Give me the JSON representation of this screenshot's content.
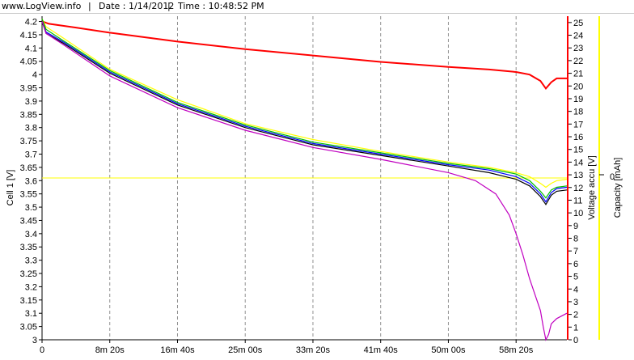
{
  "header": {
    "site": "www.LogView.info",
    "sep": "|",
    "date": "Date : 1/14/2012",
    "time": "Time : 10:48:52 PM"
  },
  "chart_data": {
    "type": "line",
    "x_tick_labels": [
      "0",
      "8m 20s",
      "16m 40s",
      "25m 00s",
      "33m 20s",
      "41m 40s",
      "50m 00s",
      "58m 20s"
    ],
    "x_tick_seconds": [
      0,
      500,
      1000,
      1500,
      2000,
      2500,
      3000,
      3500
    ],
    "xlim": [
      0,
      3875
    ],
    "axes": {
      "left": {
        "label": "Cell 1 [V]",
        "ylim": [
          3.0,
          4.22
        ],
        "ticks": [
          3,
          3.05,
          3.1,
          3.15,
          3.2,
          3.25,
          3.3,
          3.35,
          3.4,
          3.45,
          3.5,
          3.55,
          3.6,
          3.65,
          3.7,
          3.75,
          3.8,
          3.85,
          3.9,
          3.95,
          4,
          4.05,
          4.1,
          4.15,
          4.2
        ],
        "color": "#000000"
      },
      "right1": {
        "label": "Voltage accu [V]",
        "ylim": [
          0,
          25.5
        ],
        "ticks": [
          0,
          1,
          2,
          3,
          4,
          5,
          6,
          7,
          8,
          9,
          10,
          11,
          12,
          13,
          14,
          15,
          16,
          17,
          18,
          19,
          20,
          21,
          22,
          23,
          24,
          25
        ],
        "color": "#ff0000"
      },
      "right2": {
        "label": "Capacity [mAh]",
        "tick_label": "0",
        "color": "#ffff00"
      }
    },
    "grid": "vertical-dashed",
    "series": [
      {
        "axis": "right1",
        "color": "#ff0000",
        "x": [
          0,
          50,
          250,
          500,
          1000,
          1500,
          2000,
          2500,
          3000,
          3300,
          3500,
          3600,
          3680,
          3720,
          3760,
          3800,
          3875
        ],
        "y": [
          25.1,
          24.9,
          24.6,
          24.2,
          23.5,
          22.9,
          22.4,
          21.9,
          21.5,
          21.3,
          21.1,
          20.9,
          20.4,
          19.8,
          20.3,
          20.6,
          20.6
        ]
      },
      {
        "axis": "left",
        "color": "#ffff00",
        "x": [
          0,
          30,
          150,
          500,
          1000,
          1500,
          2000,
          2500,
          3000,
          3300,
          3500,
          3600,
          3680,
          3720,
          3760,
          3800,
          3875
        ],
        "y": [
          4.21,
          4.18,
          4.14,
          4.02,
          3.905,
          3.815,
          3.755,
          3.71,
          3.67,
          3.65,
          3.63,
          3.615,
          3.59,
          3.575,
          3.59,
          3.6,
          3.605
        ]
      },
      {
        "axis": "left",
        "color": "#00c000",
        "x": [
          0,
          30,
          150,
          500,
          1000,
          1500,
          2000,
          2500,
          3000,
          3300,
          3500,
          3600,
          3680,
          3720,
          3760,
          3800,
          3875
        ],
        "y": [
          4.21,
          4.17,
          4.13,
          4.015,
          3.895,
          3.81,
          3.745,
          3.705,
          3.665,
          3.645,
          3.625,
          3.6,
          3.56,
          3.535,
          3.565,
          3.575,
          3.58
        ]
      },
      {
        "axis": "left",
        "color": "#0000ff",
        "x": [
          0,
          30,
          150,
          500,
          1000,
          1500,
          2000,
          2500,
          3000,
          3300,
          3500,
          3600,
          3680,
          3720,
          3760,
          3800,
          3875
        ],
        "y": [
          4.2,
          4.16,
          4.125,
          4.01,
          3.89,
          3.805,
          3.74,
          3.7,
          3.66,
          3.64,
          3.615,
          3.59,
          3.55,
          3.52,
          3.555,
          3.57,
          3.575
        ]
      },
      {
        "axis": "left",
        "color": "#000000",
        "x": [
          0,
          30,
          150,
          500,
          1000,
          1500,
          2000,
          2500,
          3000,
          3300,
          3500,
          3600,
          3680,
          3720,
          3760,
          3800,
          3875
        ],
        "y": [
          4.2,
          4.155,
          4.12,
          4.005,
          3.885,
          3.8,
          3.735,
          3.695,
          3.655,
          3.63,
          3.605,
          3.58,
          3.54,
          3.51,
          3.545,
          3.56,
          3.565
        ]
      },
      {
        "axis": "left",
        "color": "#c000c0",
        "x": [
          0,
          30,
          150,
          500,
          1000,
          1500,
          2000,
          2500,
          3000,
          3200,
          3350,
          3450,
          3500,
          3550,
          3600,
          3640,
          3680,
          3700,
          3720,
          3740,
          3760,
          3800,
          3875
        ],
        "y": [
          4.2,
          4.155,
          4.115,
          3.995,
          3.875,
          3.79,
          3.725,
          3.68,
          3.63,
          3.6,
          3.55,
          3.47,
          3.4,
          3.32,
          3.23,
          3.17,
          3.11,
          3.05,
          3.0,
          3.02,
          3.06,
          3.08,
          3.1
        ]
      }
    ],
    "reference_line": {
      "axis": "left",
      "color": "#ffff00",
      "y": 3.61
    }
  }
}
